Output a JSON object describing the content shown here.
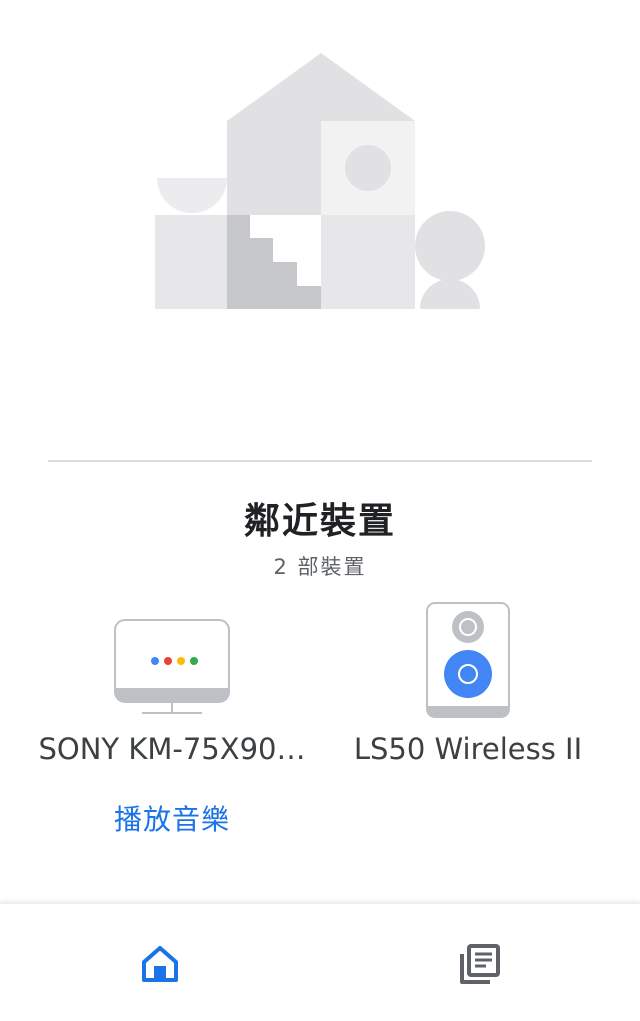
{
  "nearby": {
    "title": "鄰近裝置",
    "count_label": "2 部裝置"
  },
  "devices": [
    {
      "name": "SONY KM-75X90…",
      "icon": "tv-icon",
      "action_label": "播放音樂"
    },
    {
      "name": "LS50 Wireless II",
      "icon": "speaker-icon"
    }
  ],
  "bottom_nav": {
    "items": [
      {
        "icon": "home-icon",
        "active": true
      },
      {
        "icon": "feed-icon",
        "active": false
      }
    ],
    "active_color": "#1a73e8",
    "inactive_color": "#5f6368"
  },
  "colors": {
    "accent": "#1a73e8",
    "dot_blue": "#4285f4",
    "dot_red": "#ea4335",
    "dot_yellow": "#fbbc04",
    "dot_green": "#34a853"
  }
}
